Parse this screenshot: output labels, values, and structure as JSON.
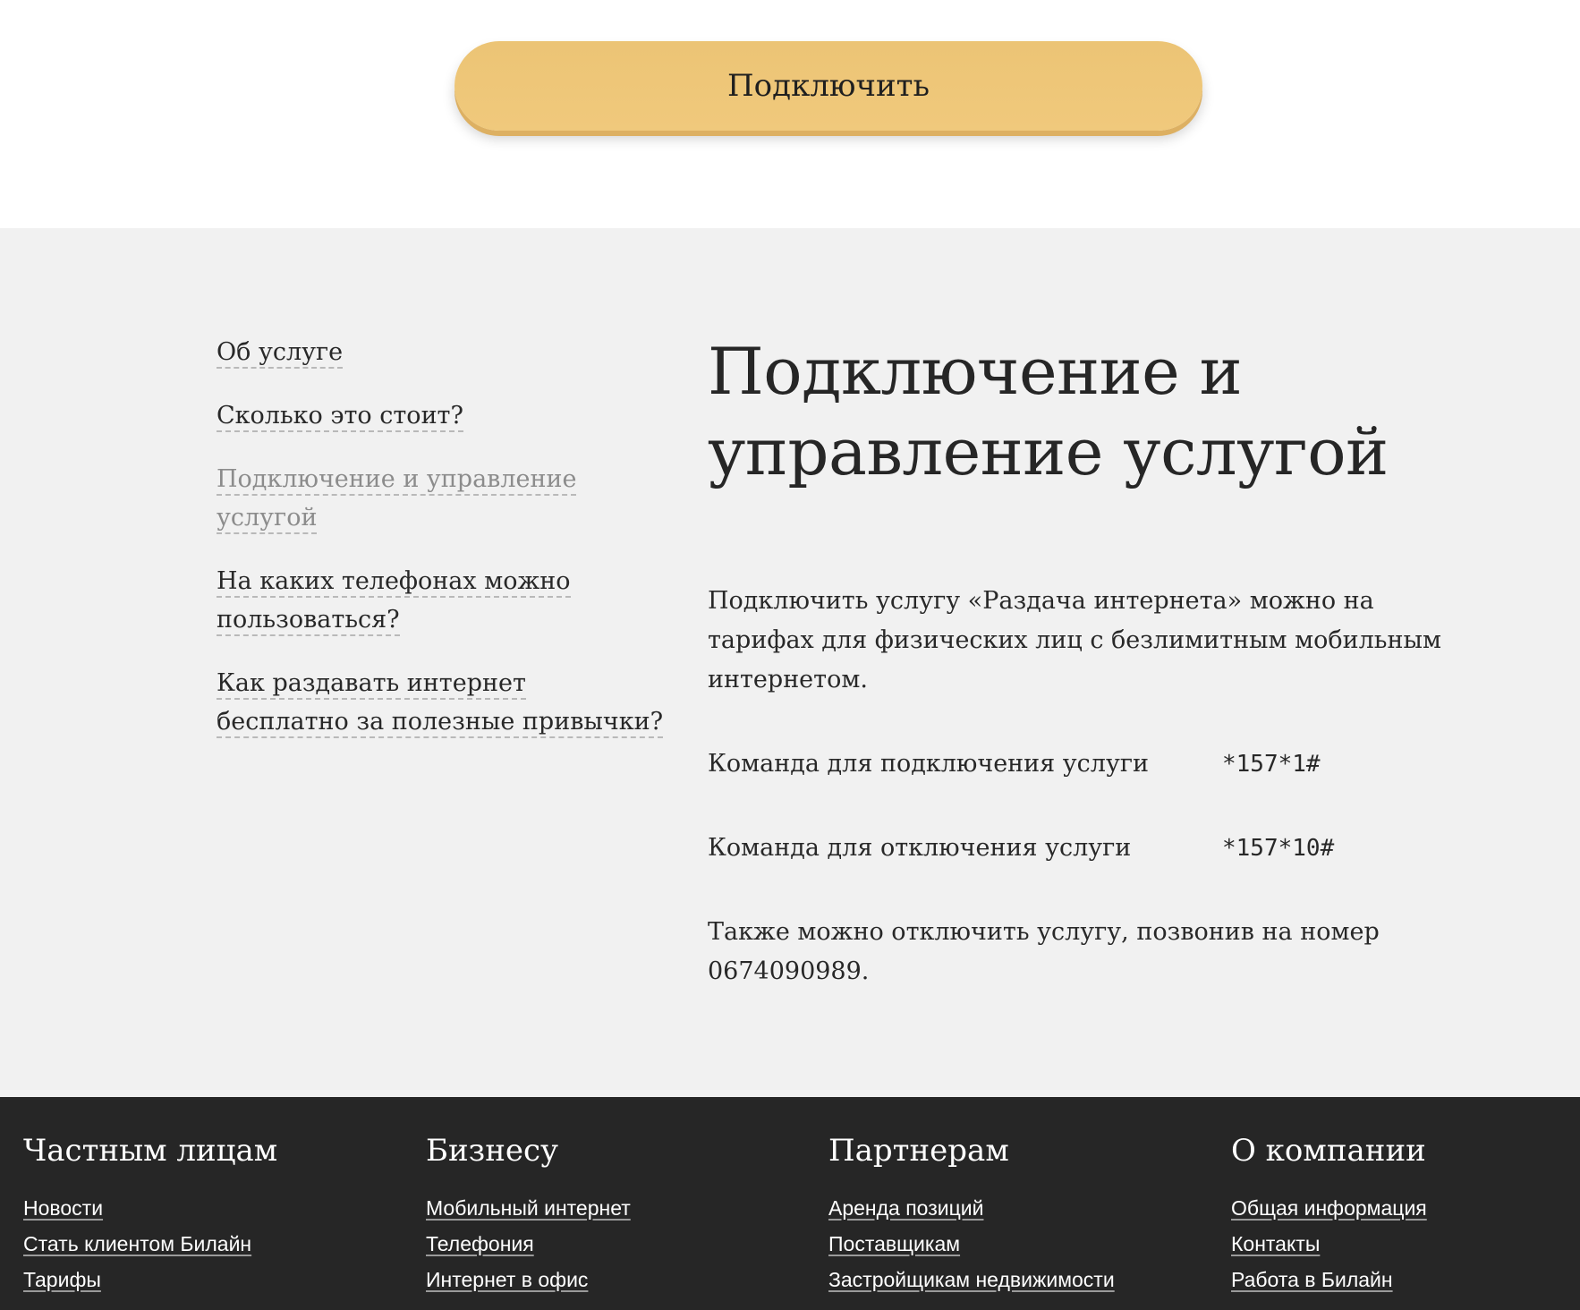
{
  "top": {
    "connect_button": "Подключить"
  },
  "toc": {
    "items": [
      {
        "label": "Об услуге"
      },
      {
        "label": "Сколько это стоит?"
      },
      {
        "label": "Подключение и управление услугой"
      },
      {
        "label": "На каких телефонах можно пользоваться?"
      },
      {
        "label": "Как раздавать интернет бесплатно за полезные привычки?"
      }
    ],
    "active_index": 2
  },
  "main": {
    "title": "Подключение и управление услугой",
    "lead": "Подключить услугу «Раздача интернета» можно на тарифах для физических лиц с безлимитным мобильным интернетом.",
    "commands": [
      {
        "label": "Команда для подключения услуги",
        "code": "*157*1#"
      },
      {
        "label": "Команда для отключения услуги",
        "code": "*157*10#"
      }
    ],
    "note": "Также можно отключить услугу, позвонив на номер 0674090989."
  },
  "footer": {
    "columns": [
      {
        "title": "Частным лицам",
        "links": [
          "Новости",
          "Стать клиентом Билайн",
          "Тарифы"
        ]
      },
      {
        "title": "Бизнесу",
        "links": [
          "Мобильный интернет",
          "Телефония",
          "Интернет в офис"
        ]
      },
      {
        "title": "Партнерам",
        "links": [
          "Аренда позиций",
          "Поставщикам",
          "Застройщикам недвижимости"
        ]
      },
      {
        "title": "О компании",
        "links": [
          "Общая информация",
          "Контакты",
          "Работа в Билайн"
        ]
      }
    ]
  },
  "colors": {
    "accent_button": "#ecc475",
    "content_bg": "#f1f1f1",
    "footer_bg": "#262626",
    "active_link": "#8c8c8c"
  }
}
